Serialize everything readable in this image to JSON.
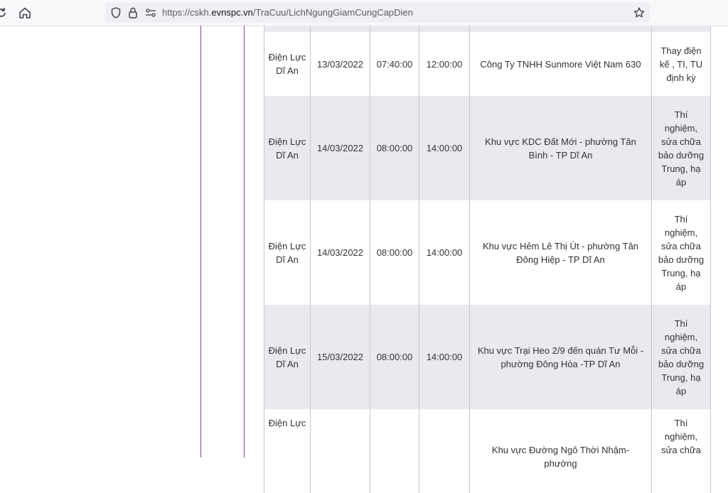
{
  "browser": {
    "url_prefix": "https://cskh.",
    "url_host": "evnspc.vn",
    "url_path": "/TraCuu/LichNgungGiamCungCapDien",
    "icons": [
      "reload-icon",
      "home-icon",
      "shield-icon",
      "lock-icon",
      "permissions-icon",
      "star-icon"
    ]
  },
  "table": {
    "rows": [
      {
        "unit": "Điện Lực Dĩ An",
        "date": "13/03/2022",
        "start": "07:40:00",
        "end": "12:00:00",
        "area": "Công Ty TNHH Sunmore Việt Nam 630",
        "reason": "Thay điện kế , TI, TU định kỳ"
      },
      {
        "unit": "Điện Lực Dĩ An",
        "date": "14/03/2022",
        "start": "08:00:00",
        "end": "14:00:00",
        "area": "Khu vực KDC Đất Mới - phường Tân Bình - TP Dĩ An",
        "reason": "Thí nghiệm, sửa chữa bảo dưỡng Trung, hạ áp"
      },
      {
        "unit": "Điện Lực Dĩ An",
        "date": "14/03/2022",
        "start": "08:00:00",
        "end": "14:00:00",
        "area": "Khu vực Hẻm Lê Thị Út - phường Tân Đông Hiệp - TP Dĩ An",
        "reason": "Thí nghiệm, sửa chữa bảo dưỡng Trung, hạ áp"
      },
      {
        "unit": "Điện Lực Dĩ An",
        "date": "15/03/2022",
        "start": "08:00:00",
        "end": "14:00:00",
        "area": "Khu vực Trại Heo 2/9 đến quán Tư Mỗi - phường Đông Hòa -TP Dĩ An",
        "reason": "Thí nghiệm, sửa chữa bảo dưỡng Trung, hạ áp"
      },
      {
        "unit": "Điện Lực",
        "date": "",
        "start": "",
        "end": "",
        "area": "Khu vực Đường Ngô Thời Nhậm- phường",
        "reason": "Thí nghiệm, sửa chữa"
      }
    ]
  },
  "colors": {
    "shade": "#ebe8f0",
    "frame": "#7a4aa5"
  }
}
